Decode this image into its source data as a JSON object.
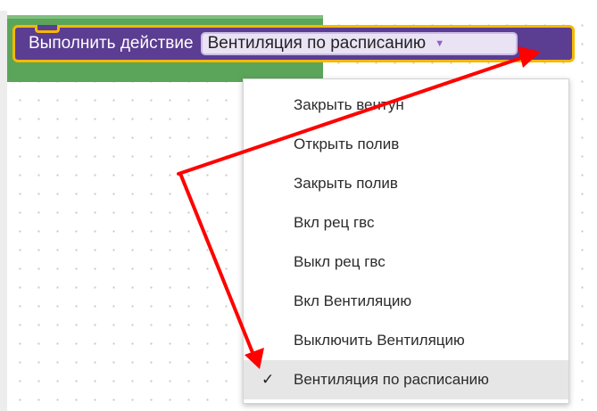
{
  "block": {
    "label": "Выполнить действие",
    "selected_value": "Вентиляция по расписанию",
    "dropdown_arrow": "▼"
  },
  "menu": {
    "items": [
      {
        "label": "Закрыть вентун"
      },
      {
        "label": "Открыть полив"
      },
      {
        "label": "Закрыть полив"
      },
      {
        "label": "Вкл рец гвс"
      },
      {
        "label": "Выкл рец гвс"
      },
      {
        "label": "Вкл Вентиляцию"
      },
      {
        "label": "Выключить Вентиляцию"
      },
      {
        "label": "Вентиляция по расписанию",
        "check": "✓"
      }
    ]
  },
  "colors": {
    "block_purple": "#5b3d92",
    "block_highlight": "#f5b800",
    "green_block": "#5ba55b",
    "annotation_arrow": "#ff0000",
    "selected_item_bg": "#e6e6e6"
  }
}
